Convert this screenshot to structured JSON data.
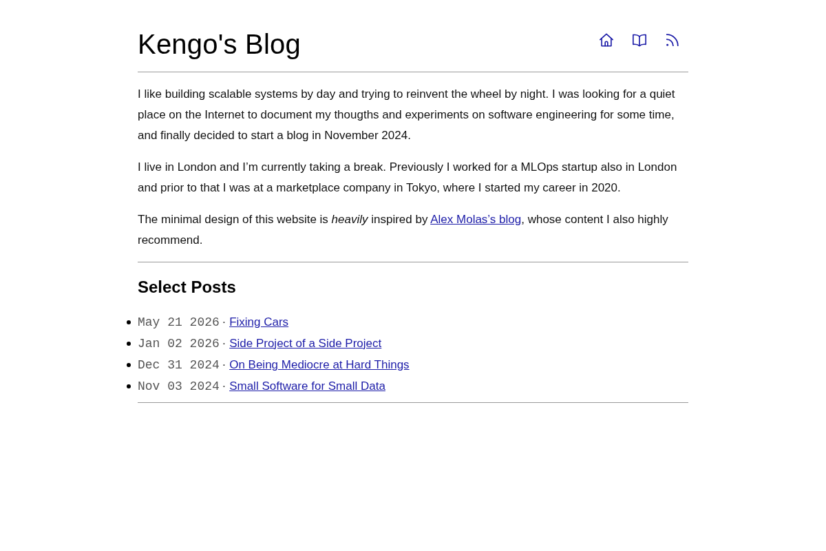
{
  "header": {
    "title": "Kengo's Blog"
  },
  "about": [
    {
      "parts": [
        {
          "kind": "text",
          "text": "I like building scalable systems by day and trying to reinvent the wheel by night. I was looking for a quiet place on the Internet to document my thougths and experiments on software engineering for some time, and finally decided to start a blog in November 2024."
        }
      ]
    },
    {
      "parts": [
        {
          "kind": "text",
          "text": "I live in London and I’m currently taking a break. Previously I worked for a MLOps startup also in London and prior to that I was at a marketplace company in Tokyo, where I started my career in 2020."
        }
      ]
    },
    {
      "parts": [
        {
          "kind": "text",
          "text": "The minimal design of this website is *heavily* inspired by "
        },
        {
          "kind": "link",
          "text": "Alex Molas’s blog"
        },
        {
          "kind": "text",
          "text": ", whose content I also highly recommend."
        }
      ]
    }
  ],
  "posts": {
    "heading": "Select Posts",
    "items": [
      {
        "date": "May 21 2026",
        "separator": "·",
        "title": "Fixing Cars"
      },
      {
        "date": "Jan 02 2026",
        "separator": "·",
        "title": "Side Project of a Side Project"
      },
      {
        "date": "Dec 31 2024",
        "separator": "·",
        "title": "On Being Mediocre at Hard Things"
      },
      {
        "date": "Nov 03 2024",
        "separator": "·",
        "title": "Small Software for Small Data"
      }
    ]
  }
}
